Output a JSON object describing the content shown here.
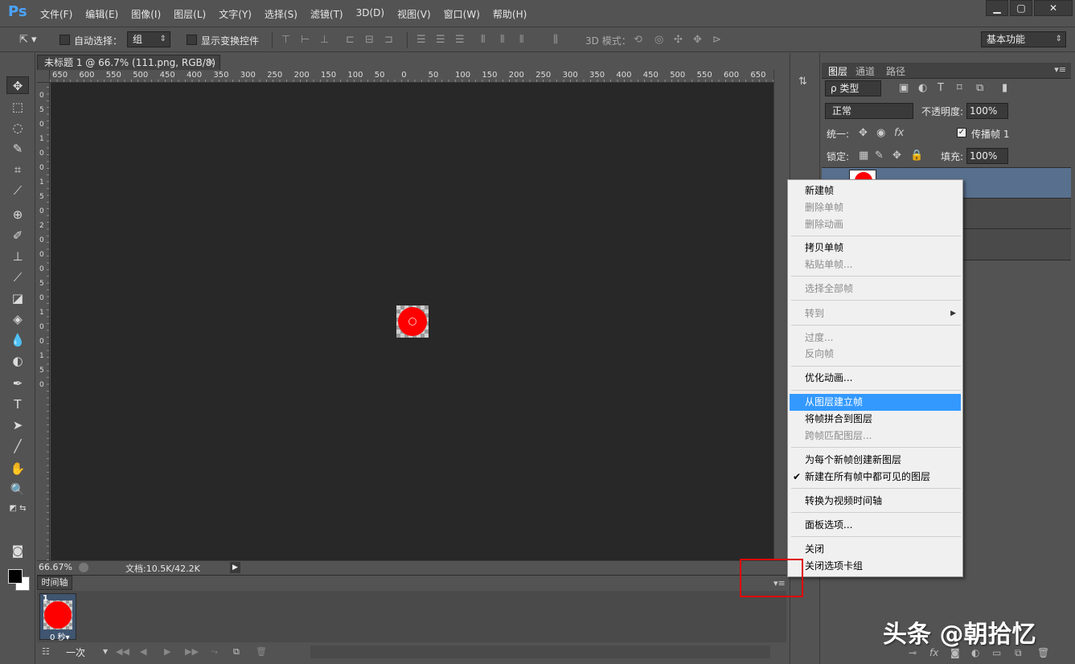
{
  "app": {
    "logo": "Ps"
  },
  "menu": [
    "文件(F)",
    "编辑(E)",
    "图像(I)",
    "图层(L)",
    "文字(Y)",
    "选择(S)",
    "滤镜(T)",
    "3D(D)",
    "视图(V)",
    "窗口(W)",
    "帮助(H)"
  ],
  "window_controls": {
    "minimize": "▁",
    "maximize": "▢",
    "close": "✕"
  },
  "options": {
    "auto_select_label": "自动选择：",
    "auto_select_value": "组",
    "show_transform_label": "显示变换控件",
    "mode_3d_label": "3D 模式：",
    "workspace": "基本功能"
  },
  "document": {
    "tab_title": "未标题 1 @ 66.7% (111.png, RGB/8) *",
    "ruler_h_labels": [
      "650",
      "600",
      "550",
      "500",
      "450",
      "400",
      "350",
      "300",
      "250",
      "200",
      "150",
      "100",
      "50",
      "0",
      "50",
      "100",
      "150",
      "200",
      "250",
      "300",
      "350",
      "400",
      "450",
      "500",
      "550",
      "600",
      "650"
    ],
    "ruler_v_labels": [
      "0",
      "5",
      "0",
      "1",
      "0",
      "0",
      "1",
      "5",
      "0",
      "2",
      "0",
      "0",
      "0",
      "5",
      "0",
      "1",
      "0",
      "0",
      "1",
      "5",
      "0"
    ]
  },
  "status": {
    "zoom": "66.67%",
    "doc_size": "文档:10.5K/42.2K"
  },
  "timeline": {
    "tab": "时间轴",
    "frame_number": "1",
    "frame_delay": "0 秒▾",
    "loop": "一次"
  },
  "layers_panel": {
    "tabs": [
      "图层",
      "通道",
      "路径"
    ],
    "filter": "ρ 类型",
    "blend_mode": "正常",
    "opacity_label": "不透明度:",
    "opacity_value": "100%",
    "unify_label": "统一:",
    "propagate_label": "传播帧 1",
    "lock_label": "锁定:",
    "fill_label": "填充:",
    "fill_value": "100%"
  },
  "context_menu": {
    "items": [
      {
        "label": "新建帧",
        "enabled": true
      },
      {
        "label": "删除单帧",
        "enabled": false
      },
      {
        "label": "删除动画",
        "enabled": false
      },
      {
        "label": "拷贝单帧",
        "enabled": true
      },
      {
        "label": "粘贴单帧...",
        "enabled": false
      },
      {
        "label": "选择全部帧",
        "enabled": false
      },
      {
        "label": "转到",
        "enabled": false
      },
      {
        "label": "过度...",
        "enabled": false
      },
      {
        "label": "反向帧",
        "enabled": false
      },
      {
        "label": "优化动画...",
        "enabled": true
      },
      {
        "label": "从图层建立帧",
        "enabled": true,
        "highlighted": true
      },
      {
        "label": "将帧拼合到图层",
        "enabled": true
      },
      {
        "label": "跨帧匹配图层...",
        "enabled": false
      },
      {
        "label": "为每个新帧创建新图层",
        "enabled": true
      },
      {
        "label": "新建在所有帧中都可见的图层",
        "enabled": true,
        "checked": true
      },
      {
        "label": "转换为视频时间轴",
        "enabled": true
      },
      {
        "label": "面板选项...",
        "enabled": true
      },
      {
        "label": "关闭",
        "enabled": true
      },
      {
        "label": "关闭选项卡组",
        "enabled": true
      }
    ],
    "check_mark": "✔",
    "submenu_arrow": "▶"
  },
  "watermark": "头条 @朝拾忆"
}
